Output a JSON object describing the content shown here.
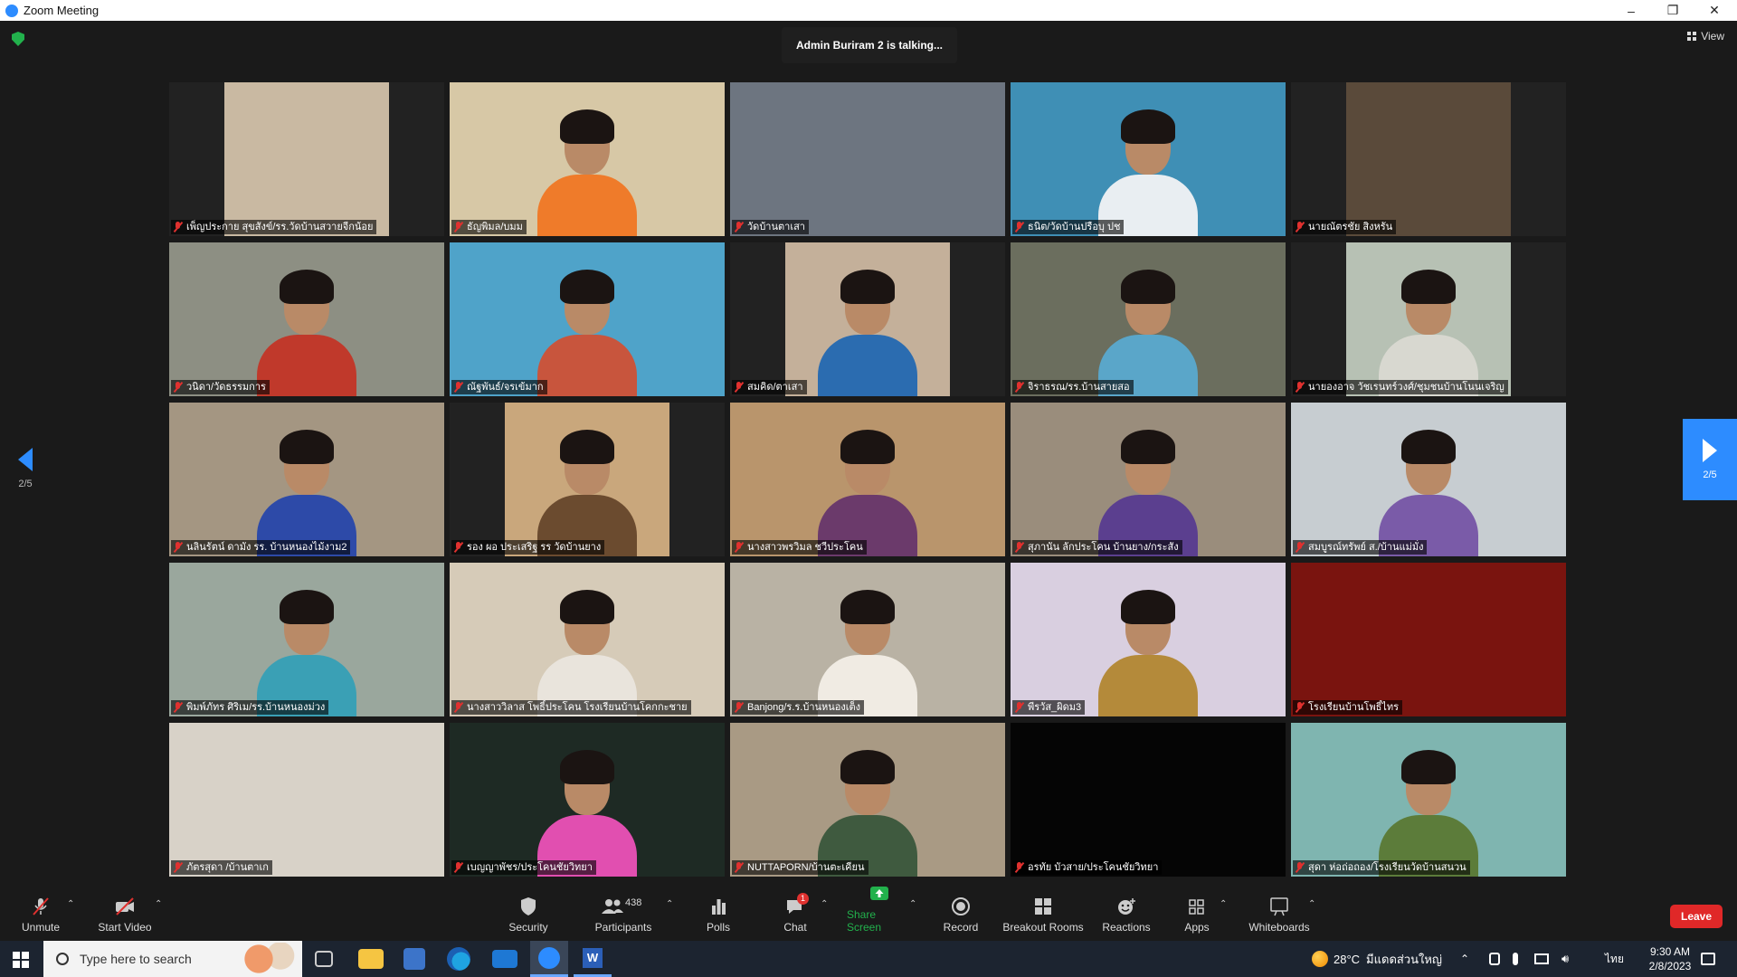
{
  "window": {
    "title": "Zoom Meeting",
    "controls": [
      "–",
      "❐",
      "✕"
    ]
  },
  "stage": {
    "talking_banner": "Admin Buriram 2 is talking...",
    "view_label": "View",
    "page_indicator": "2/5"
  },
  "tiles": [
    {
      "name": "เพ็ญประกาย สุขสังข์/รร.วัดบ้านสวายจีกน้อย",
      "bg": "#c9b9a2",
      "accent": "#d8cfc2",
      "person": false,
      "inset": true
    },
    {
      "name": "ธัญพิมล/บมม",
      "bg": "#d7c8a6",
      "accent": "#ef7b2a",
      "person": true,
      "inset": false
    },
    {
      "name": "วัดบ้านตาเสา",
      "bg": "#6d7580",
      "accent": "#3b4a5a",
      "person": false,
      "inset": false
    },
    {
      "name": "ธนิต/วัดบ้านปรือบุ ปช",
      "bg": "#3f8fb5",
      "accent": "#e9eef2",
      "person": true,
      "inset": false
    },
    {
      "name": "นายณัตรชัย สิงหรัน",
      "bg": "#5a4a3a",
      "accent": "#cfd4d8",
      "person": false,
      "inset": true
    },
    {
      "name": "วนิดา/วัดธรรมการ",
      "bg": "#8d8f83",
      "accent": "#c0392b",
      "person": true,
      "inset": false
    },
    {
      "name": "ณัฐพันธ์/จรเข้มาก",
      "bg": "#4fa3c9",
      "accent": "#c8553d",
      "person": true,
      "inset": false
    },
    {
      "name": "สมคิด/ตาเสา",
      "bg": "#c4b09a",
      "accent": "#2b6cb0",
      "person": true,
      "inset": true
    },
    {
      "name": "จิราธรณ/รร.บ้านสายสอ",
      "bg": "#6b6e5e",
      "accent": "#5aa6c9",
      "person": true,
      "inset": false
    },
    {
      "name": "นายองอาจ วัชเรนทร์วงศ์/ชุมชนบ้านโนนเจริญ",
      "bg": "#b7c1b4",
      "accent": "#d8d8d0",
      "person": true,
      "inset": true
    },
    {
      "name": "นลินรัตน์ ดามัง รร. บ้านหนองไม้งาม2",
      "bg": "#a49682",
      "accent": "#2d4aa8",
      "person": true,
      "inset": false
    },
    {
      "name": "รอง ผอ ประเสริฐ รร วัดบ้านยาง",
      "bg": "#c9a77c",
      "accent": "#6b4b2f",
      "person": true,
      "inset": true
    },
    {
      "name": "นางสาวพรวิมล ชวีประโคน",
      "bg": "#b9956c",
      "accent": "#6b3a6b",
      "person": true,
      "inset": false
    },
    {
      "name": "สุภานัน ลักประโคน บ้านยาง/กระสัง",
      "bg": "#9a8d7c",
      "accent": "#5b3f8f",
      "person": true,
      "inset": false
    },
    {
      "name": "สมบูรณ์ทรัพย์ ส./บ้านแม่มั่ง",
      "bg": "#c7cdd1",
      "accent": "#7a5ba8",
      "person": true,
      "inset": false
    },
    {
      "name": "พิมพ์ภัทร ศิริเม/รร.บ้านหนองม่วง",
      "bg": "#9aa79d",
      "accent": "#3aa0b5",
      "person": true,
      "inset": false
    },
    {
      "name": "นางสาววิลาส โพธิ์ประโคน โรงเรียนบ้านโคกกะชาย",
      "bg": "#d6cbb8",
      "accent": "#e9e4dc",
      "person": true,
      "inset": false
    },
    {
      "name": "Banjong/ร.ร.บ้านหนองเต็ง",
      "bg": "#b9b2a4",
      "accent": "#f0ebe3",
      "person": true,
      "inset": false
    },
    {
      "name": "พีรวัส_ผิดม3",
      "bg": "#d9cfe0",
      "accent": "#b48a3a",
      "person": true,
      "inset": false
    },
    {
      "name": "โรงเรียนบ้านโพธิ์ไทร",
      "bg": "#7a140f",
      "accent": "#8e1b14",
      "person": false,
      "inset": false
    },
    {
      "name": "ภัตรสุดา /บ้านตาเก",
      "bg": "#d8d2c8",
      "accent": "#a3532a",
      "person": false,
      "inset": false
    },
    {
      "name": "เบญญาพัชร/ประโคนชัยวิทยา",
      "bg": "#1e2a24",
      "accent": "#e14fb0",
      "person": true,
      "inset": false
    },
    {
      "name": "NUTTAPORN/บ้านตะเคียน",
      "bg": "#a99a84",
      "accent": "#3f5a3f",
      "person": true,
      "inset": false
    },
    {
      "name": "อรทัย บัวสาย/ประโคนชัยวิทยา",
      "bg": "#050505",
      "accent": "#050505",
      "person": false,
      "inset": false
    },
    {
      "name": "สุดา ห่อถ่อถอง/โรงเรียนวัดบ้านสนวน",
      "bg": "#7fb5b0",
      "accent": "#5c7c3a",
      "person": true,
      "inset": false
    }
  ],
  "toolbar": {
    "unmute": "Unmute",
    "start_video": "Start Video",
    "security": "Security",
    "participants": "Participants",
    "participants_count": "438",
    "polls": "Polls",
    "chat": "Chat",
    "chat_badge": "1",
    "share_screen": "Share Screen",
    "record": "Record",
    "breakout_rooms": "Breakout Rooms",
    "reactions": "Reactions",
    "apps": "Apps",
    "whiteboards": "Whiteboards",
    "leave": "Leave"
  },
  "taskbar": {
    "search_placeholder": "Type here to search",
    "weather": "28°C",
    "weather_text": "มีแดดส่วนใหญ่",
    "lang": "ไทย",
    "time": "9:30 AM",
    "date": "2/8/2023"
  },
  "colors": {
    "accent": "#2d8cff",
    "leave": "#e02828",
    "share": "#22b14c"
  }
}
